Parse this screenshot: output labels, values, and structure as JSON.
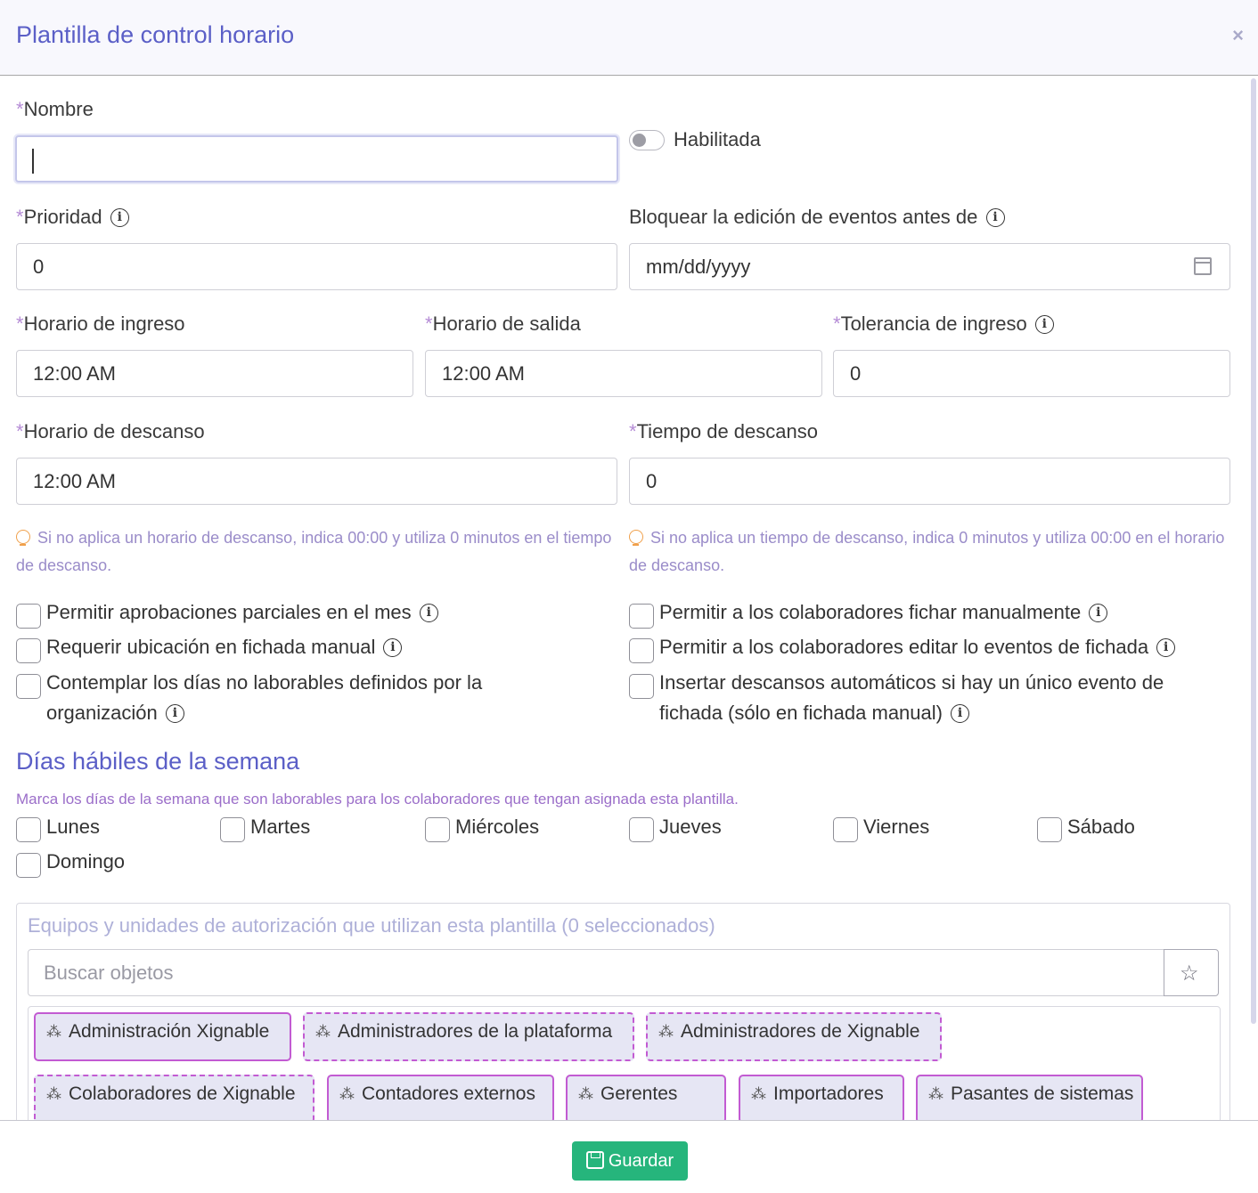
{
  "modal": {
    "title": "Plantilla de control horario",
    "close": "×"
  },
  "form": {
    "name_label": "Nombre",
    "name_value": "",
    "enabled_label": "Habilitada",
    "enabled": false,
    "priority_label": "Prioridad",
    "priority_value": "0",
    "lock_label": "Bloquear la edición de eventos antes de",
    "lock_placeholder": "mm/dd/yyyy",
    "entry_label": "Horario de ingreso",
    "entry_value": "12:00 AM",
    "exit_label": "Horario de salida",
    "exit_value": "12:00 AM",
    "tolerance_label": "Tolerancia de ingreso",
    "tolerance_value": "0",
    "break_time_label": "Horario de descanso",
    "break_time_value": "12:00 AM",
    "break_duration_label": "Tiempo de descanso",
    "break_duration_value": "0",
    "hint_left": "Si no aplica un horario de descanso, indica 00:00 y utiliza 0 minutos en el tiempo de descanso.",
    "hint_right": "Si no aplica un tiempo de descanso, indica 0 minutos y utiliza 00:00 en el horario de descanso.",
    "required_mark": "*"
  },
  "options": {
    "partial_approvals": "Permitir aprobaciones parciales en el mes",
    "manual_clock": "Permitir a los colaboradores fichar manualmente",
    "require_location": "Requerir ubicación en fichada manual",
    "edit_events": "Permitir a los colaboradores editar lo eventos de fichada",
    "non_working_days_1": "Contemplar los días no laborables definidos por la",
    "non_working_days_2": "organización",
    "auto_breaks_1": "Insertar descansos automáticos si hay un único evento de",
    "auto_breaks_2": "fichada (sólo en fichada manual)"
  },
  "weekdays": {
    "title": "Días hábiles de la semana",
    "subtitle": "Marca los días de la semana que son laborables para los colaboradores que tengan asignada esta plantilla.",
    "days": [
      "Lunes",
      "Martes",
      "Miércoles",
      "Jueves",
      "Viernes",
      "Sábado",
      "Domingo"
    ]
  },
  "teams": {
    "title": "Equipos y unidades de autorización que utilizan esta plantilla (0 seleccionados)",
    "search_placeholder": "Buscar objetos",
    "tags": [
      "Administración Xignable",
      "Administradores de la plataforma",
      "Administradores de Xignable",
      "Colaboradores de Xignable",
      "Contadores externos",
      "Gerentes",
      "Importadores",
      "Pasantes de sistemas"
    ]
  },
  "footer": {
    "save_label": "Guardar"
  },
  "icons": {
    "info": "info-icon",
    "bulb": "lightbulb-icon",
    "calendar": "calendar-icon",
    "team": "team-icon",
    "favorite": "star-filter-icon",
    "save": "floppy-disk-icon"
  },
  "colors": {
    "accent": "#5b5fc7",
    "required": "#b58cd6",
    "tag_border": "#c25bd2",
    "tag_bg": "#e6e6f4",
    "save": "#26b57c",
    "hint": "#9a8cc9"
  }
}
